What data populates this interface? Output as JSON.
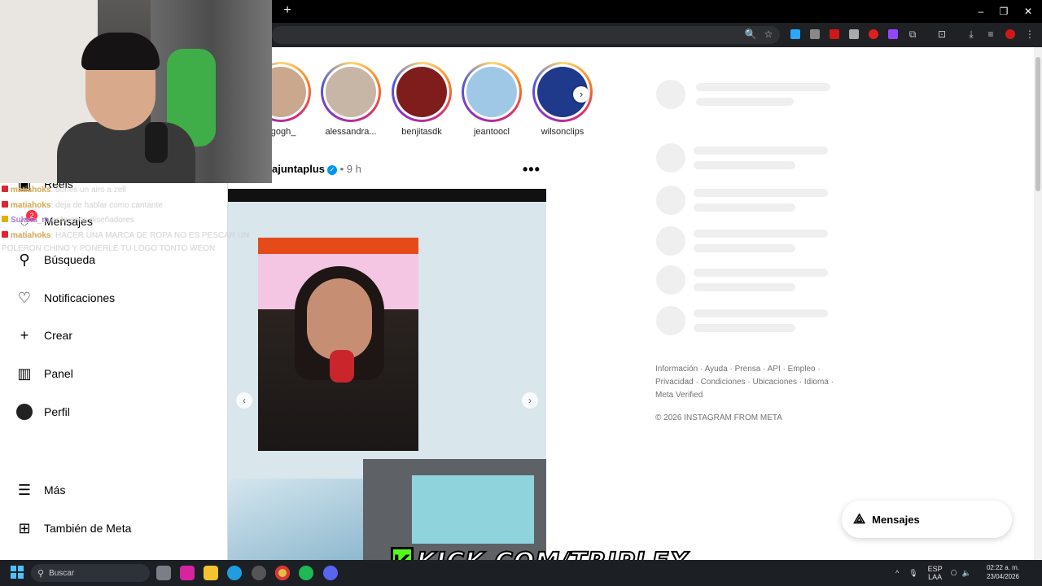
{
  "browser": {
    "new_tab_label": "+",
    "window_controls": [
      "–",
      "❐",
      "✕"
    ]
  },
  "stories": [
    {
      "name": "ngogh_",
      "color": "#caa88e"
    },
    {
      "name": "alessandra...",
      "color": "#c7b6a5"
    },
    {
      "name": "benjitasdk",
      "color": "#7f1d1d"
    },
    {
      "name": "jeantoocl",
      "color": "#9ec8e6"
    },
    {
      "name": "wilsonclips",
      "color": "#1f3a8a"
    }
  ],
  "post": {
    "username": "ajuntaplus",
    "verified_mark": "✓",
    "time": " • 9 h",
    "more": "•••"
  },
  "sidebar": {
    "items": [
      {
        "label": "Reels",
        "icon": "reels-icon"
      },
      {
        "label": "Mensajes",
        "icon": "messenger-icon"
      },
      {
        "label": "Búsqueda",
        "icon": "search-icon"
      },
      {
        "label": "Notificaciones",
        "icon": "heart-icon"
      },
      {
        "label": "Crear",
        "icon": "plus-icon"
      },
      {
        "label": "Panel",
        "icon": "chart-icon"
      },
      {
        "label": "Perfil",
        "icon": "avatar-icon"
      },
      {
        "label": "Más",
        "icon": "menu-icon"
      },
      {
        "label": "También de Meta",
        "icon": "meta-grid-icon"
      }
    ],
    "messages_badge": "2"
  },
  "chat": [
    {
      "user": "matiahoks",
      "text": ": dones un airo a zell"
    },
    {
      "user": "matiahoks",
      "text": ": deja de hablar como cantante"
    },
    {
      "user": "Sulana_m",
      "text": "er buenos diseñadores"
    },
    {
      "user": "matiahoks",
      "text": ": HACER UNA MARCA DE ROPA NO ES PESCAR UN"
    },
    {
      "user": "",
      "text": "POLERON CHINO Y PONERLE TU LOGO TONTO WEON"
    }
  ],
  "footer": {
    "links": "Información · Ayuda · Prensa · API · Empleo · Privacidad · Condiciones · Ubicaciones · Idioma · Meta Verified",
    "copyright": "© 2026 INSTAGRAM FROM META"
  },
  "dm_pill": {
    "label": "Mensajes"
  },
  "kick": {
    "logo": "K",
    "text": "KICK.COM/TRIPLEX"
  },
  "taskbar": {
    "search_placeholder": "Buscar",
    "lang": "ESP",
    "lang2": "LAA",
    "time": "02:22 a. m.",
    "date": "23/04/2026"
  },
  "colors": {
    "instagram_badge": "#ff3040",
    "kick_green": "#53fc18",
    "verified_blue": "#0095f6"
  }
}
